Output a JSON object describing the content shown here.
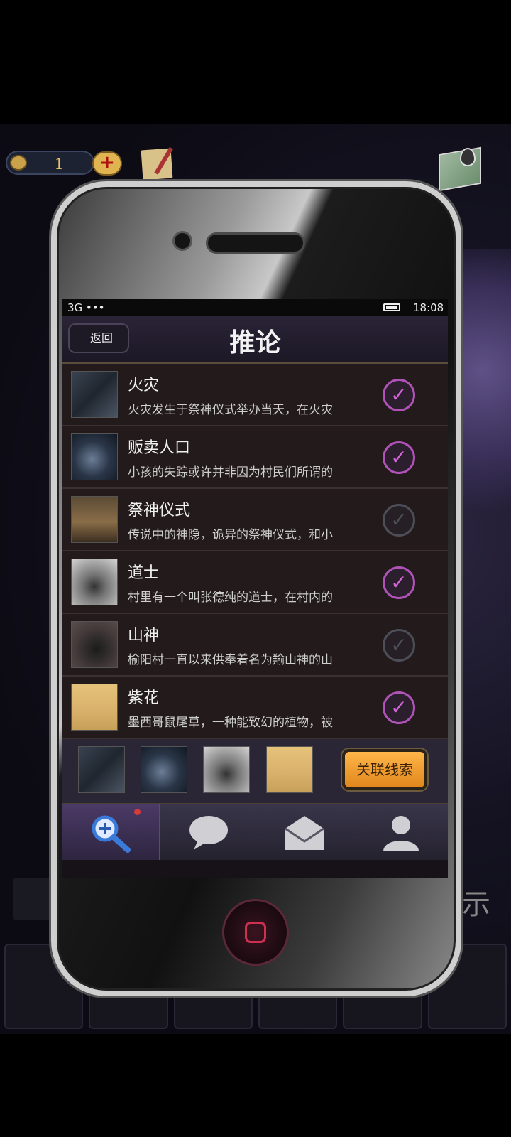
{
  "hud": {
    "coin_count": "1",
    "plus_label": "+",
    "coin_icon": "coin-icon",
    "notes_icon": "notes-icon",
    "map_icon": "map-icon"
  },
  "status": {
    "carrier": "3G •••",
    "time": "18:08"
  },
  "nav": {
    "back_label": "返回",
    "title": "推论"
  },
  "clues": [
    {
      "title": "火灾",
      "desc": "火灾发生于祭神仪式举办当天，在火灾",
      "checked": true
    },
    {
      "title": "贩卖人口",
      "desc": "小孩的失踪或许并非因为村民们所谓的",
      "checked": true
    },
    {
      "title": "祭神仪式",
      "desc": "传说中的神隐，诡异的祭神仪式，和小",
      "checked": false
    },
    {
      "title": "道士",
      "desc": "村里有一个叫张德纯的道士，在村内的",
      "checked": true
    },
    {
      "title": "山神",
      "desc": "榆阳村一直以来供奉着名为羭山神的山",
      "checked": false
    },
    {
      "title": "紫花",
      "desc": "墨西哥鼠尾草，一种能致幻的植物，被",
      "checked": true
    }
  ],
  "link_bar": {
    "button_label": "关联线索"
  },
  "tabs": [
    "magnifier-icon",
    "chat-icon",
    "mail-icon",
    "profile-icon"
  ],
  "colors": {
    "accent_check": "#b052b8",
    "link_button": "#f2a23a"
  },
  "side": {
    "right_glyph": "示"
  }
}
